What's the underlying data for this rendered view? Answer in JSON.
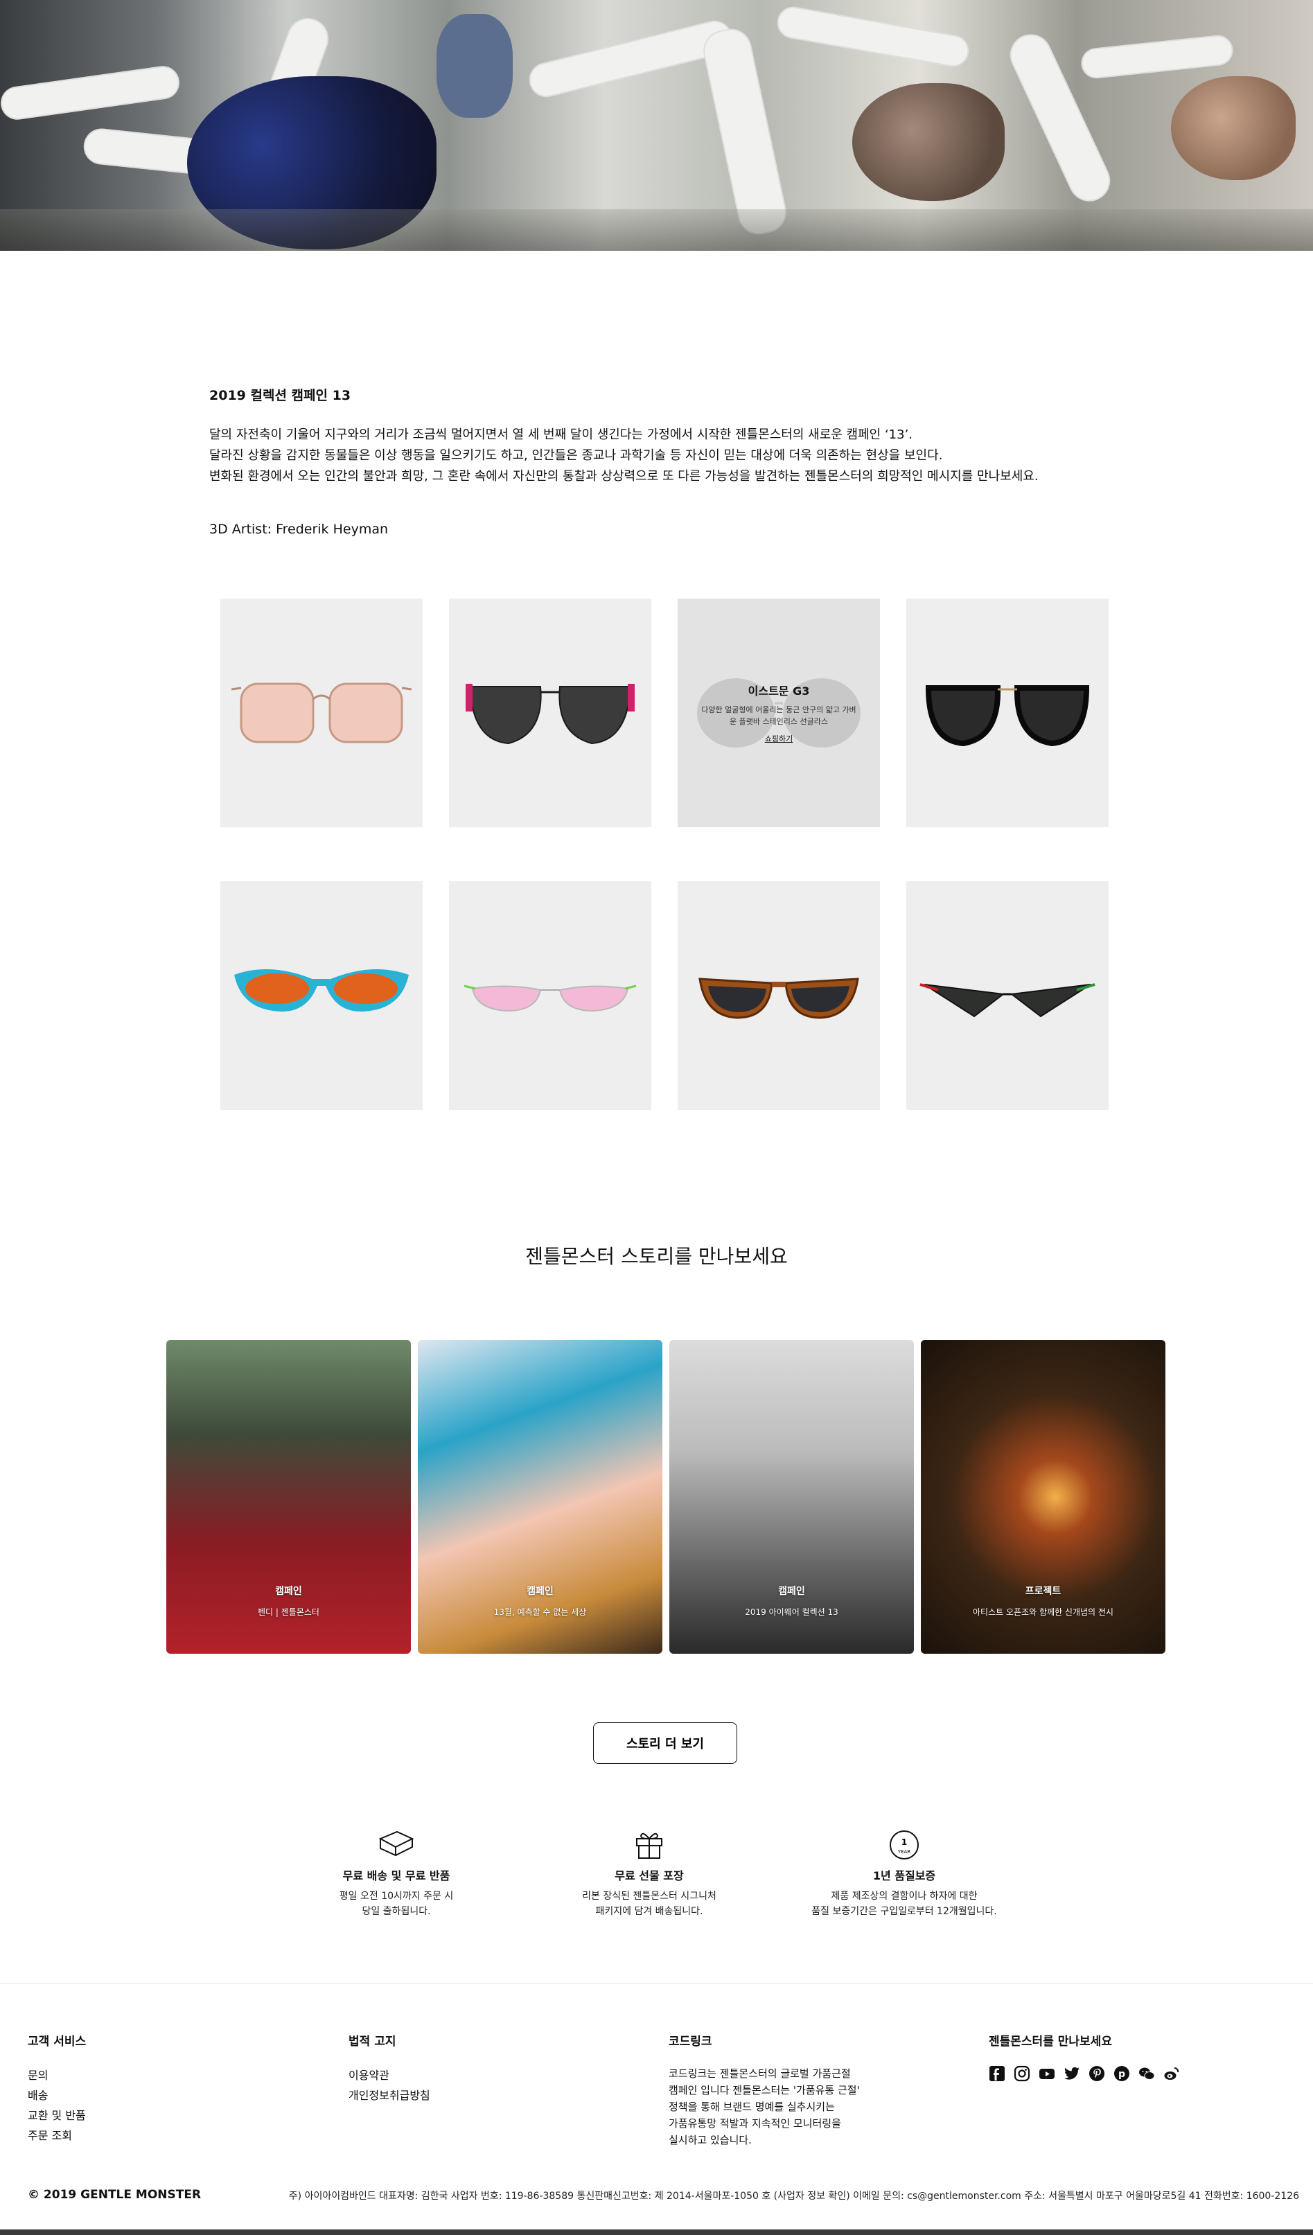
{
  "intro": {
    "title": "2019 컬렉션 캠페인 13",
    "lines": [
      "달의 자전축이 기울어 지구와의 거리가 조금씩 멀어지면서 열 세 번째 달이 생긴다는 가정에서 시작한 젠틀몬스터의 새로운 캠페인 ‘13’.",
      "달라진 상황을 감지한 동물들은 이상 행동을 일으키기도 하고, 인간들은 종교나 과학기술 등 자신이 믿는 대상에 더욱 의존하는 현상을 보인다.",
      "변화된 환경에서 오는 인간의 불안과 희망, 그 혼란 속에서 자신만의 통찰과 상상력으로 또 다른 가능성을 발견하는 젠틀몬스터의 희망적인 메시지를 만나보세요."
    ],
    "artist": "3D Artist: Frederik Heyman"
  },
  "products": {
    "hover": {
      "name": "이스트문 G3",
      "desc": "다양한 얼굴형에 어울리는 둥근 안구의 얇고 가벼운 플랫바 스테인리스 선글라스",
      "shop": "쇼핑하기"
    },
    "items": [
      {
        "icon": "rose-gold-square-sunglasses"
      },
      {
        "icon": "dark-cat-eye-pink-temple-sunglasses"
      },
      {
        "icon": "round-grey-lens-sunglasses"
      },
      {
        "icon": "black-round-sunglasses"
      },
      {
        "icon": "blue-orange-oval-sunglasses"
      },
      {
        "icon": "pink-lens-slim-sunglasses"
      },
      {
        "icon": "tortoise-cat-eye-sunglasses"
      },
      {
        "icon": "black-geometric-sunglasses"
      }
    ]
  },
  "stories": {
    "title": "젠틀몬스터 스토리를 만나보세요",
    "items": [
      {
        "tag": "캠페인",
        "sub": "펜디 | 젠틀몬스터"
      },
      {
        "tag": "캠페인",
        "sub": "13월, 예측할 수 없는 세상"
      },
      {
        "tag": "캠페인",
        "sub": "2019 아이웨어 컬렉션 13"
      },
      {
        "tag": "프로젝트",
        "sub": "아티스트 오픈조와 함께한 신개념의 전시"
      }
    ],
    "more": "스토리 더 보기"
  },
  "features": [
    {
      "title": "무료 배송 및 무료 반품",
      "lines": [
        "평일 오전 10시까지 주문 시",
        "당일 출하됩니다."
      ],
      "icon": "box-icon"
    },
    {
      "title": "무료 선물 포장",
      "lines": [
        "리본 장식된 젠틀몬스터 시그니처",
        "패키지에 담겨 배송됩니다."
      ],
      "icon": "gift-icon"
    },
    {
      "title": "1년 품질보증",
      "lines": [
        "제품 제조상의 결함이나 하자에 대한",
        "품질 보증기간은 구입일로부터 12개월입니다."
      ],
      "icon": "warranty-icon",
      "badge_top": "1",
      "badge_bottom": "YEAR"
    }
  ],
  "footer": {
    "customer": {
      "title": "고객 서비스",
      "links": [
        "문의",
        "배송",
        "교환 및 반품",
        "주문 조회"
      ]
    },
    "legal": {
      "title": "법적 고지",
      "links": [
        "이용약관",
        "개인정보취급방침"
      ]
    },
    "code": {
      "title": "코드링크",
      "text": [
        "코드링크는 젠틀몬스터의 글로벌 가품근절",
        "캠페인 입니다 젠틀몬스터는 '가품유통 근절'",
        "정책을 통해 브랜드 명예를 실추시키는",
        "가품유통망 적발과 지속적인 모니터링을",
        "실시하고 있습니다."
      ]
    },
    "social": {
      "title": "젠틀몬스터를 만나보세요",
      "icons": [
        "facebook-icon",
        "instagram-icon",
        "youtube-icon",
        "twitter-icon",
        "pinterest-icon",
        "pinterest-alt-icon",
        "wechat-icon",
        "weibo-icon"
      ]
    },
    "copyright": "© 2019 GENTLE MONSTER",
    "info": "주) 아이아이컴바인드 대표자명: 김한국 사업자 번호: 119-86-38589 통신판매신고번호: 제 2014-서울마포-1050 호 (사업자 정보 확인) 이메일 문의: cs@gentlemonster.com 주소: 서울특별시 마포구 어울마당로5길 41 전화번호: 1600-2126"
  }
}
